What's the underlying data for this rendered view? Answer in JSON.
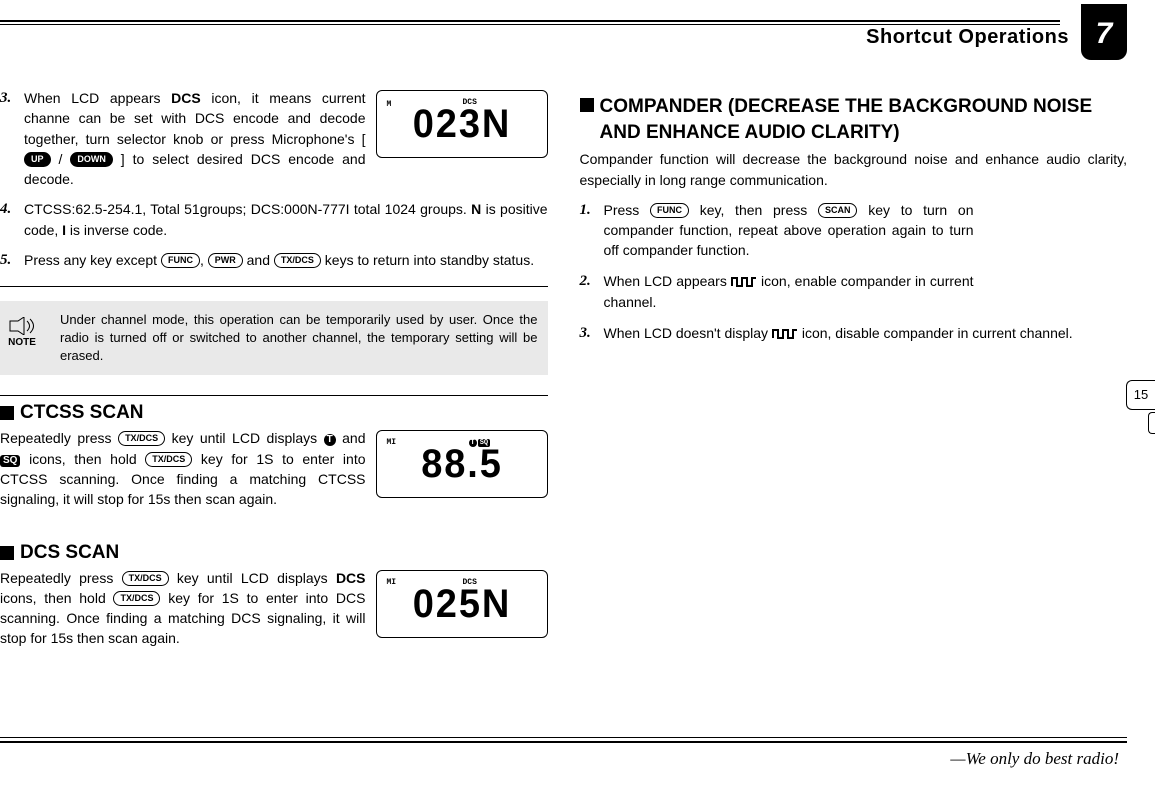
{
  "header": {
    "title": "Shortcut Operations",
    "chapter": "7"
  },
  "side_page": "15",
  "left": {
    "item3_pre": "When LCD appears ",
    "item3_icon": "DCS",
    "item3_post": " icon, it means current channe can be set with DCS encode and decode together, turn selector knob or press Microphone's [ ",
    "item3_up": "UP",
    "item3_mid": " / ",
    "item3_down": "DOWN",
    "item3_end": " ] to select desired DCS encode and decode.",
    "item4_a": "CTCSS:62.5-254.1, Total 51groups; DCS:000N-777I total 1024 groups. ",
    "item4_b": "N",
    "item4_c": " is positive code, ",
    "item4_d": "I",
    "item4_e": " is inverse code.",
    "item5_a": "Press any key except ",
    "item5_func": "FUNC",
    "item5_b": ",   ",
    "item5_pwr": "PWR",
    "item5_c": " and ",
    "item5_tx": "TX/DCS",
    "item5_d": " keys to return into standby status.",
    "note": "Under channel mode, this operation can be temporarily used by user. Once the radio is turned off or switched to another channel, the temporary setting will be erased.",
    "note_label": "NOTE",
    "sec_ctcss": "CTCSS SCAN",
    "ctcss_a": "Repeatedly press ",
    "ctcss_b": " key until LCD displays ",
    "ctcss_c": " and ",
    "ctcss_d": " icons, then hold ",
    "ctcss_e": " key for 1S to enter into CTCSS scanning. Once finding a matching CTCSS signaling, it will stop for 15s then scan again.",
    "sec_dcs": "DCS SCAN",
    "dcs_a": "Repeatedly press ",
    "dcs_b": " key until LCD displays ",
    "dcs_c": "DCS",
    "dcs_d": " icons, then hold ",
    "dcs_e": " key for 1S to enter into DCS scanning. Once finding a matching DCS signaling, it will stop for 15s then scan again.",
    "lcd1_top": "DCS",
    "lcd1_m": "M",
    "lcd1_val": "023N",
    "lcd2_mi": "MI",
    "lcd2_t": "T",
    "lcd2_sq": "SQ",
    "lcd2_val": "88.5",
    "lcd3_mi": "MI",
    "lcd3_dcs": "DCS",
    "lcd3_val": "025N"
  },
  "right": {
    "title": "COMPANDER (DECREASE THE BACKGROUND NOISE AND ENHANCE AUDIO CLARITY)",
    "intro": "Compander function will decrease the background noise and enhance audio clarity, especially in long range communication.",
    "r1_a": "Press ",
    "r1_func": "FUNC",
    "r1_b": " key, then press ",
    "r1_scan": "SCAN",
    "r1_c": " key to turn on compander function, repeat above operation again to turn off compander function.",
    "r2_a": "When LCD appears ",
    "r2_b": " icon, enable compander in current channel.",
    "r3_a": "When LCD doesn't display ",
    "r3_b": " icon, disable compander in current channel."
  },
  "footer": {
    "tagline": "We only do best radio!"
  }
}
